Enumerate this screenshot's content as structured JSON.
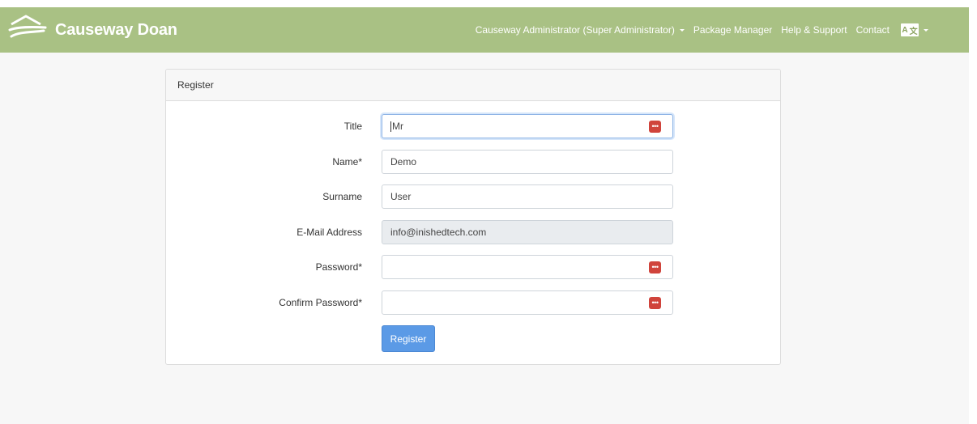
{
  "brand": {
    "name": "Causeway Doan",
    "logo_icon": "causeway-logo-icon"
  },
  "nav": {
    "user_menu": "Causeway Administrator (Super Administrator)",
    "package_manager": "Package Manager",
    "help": "Help & Support",
    "contact": "Contact",
    "language_icon": "translate-icon"
  },
  "card": {
    "header": "Register"
  },
  "form": {
    "title": {
      "label": "Title",
      "value": "Mr"
    },
    "name": {
      "label": "Name*",
      "value": "Demo"
    },
    "surname": {
      "label": "Surname",
      "value": "User"
    },
    "email": {
      "label": "E-Mail Address",
      "value": "info@inishedtech.com"
    },
    "password": {
      "label": "Password*",
      "value": ""
    },
    "confirm_password": {
      "label": "Confirm Password*",
      "value": ""
    },
    "submit": "Register",
    "password_manager_icon": "password-manager-icon"
  },
  "colors": {
    "navbar": "#a9c184",
    "button": "#5b9ae6",
    "password_icon": "#d0443c"
  }
}
